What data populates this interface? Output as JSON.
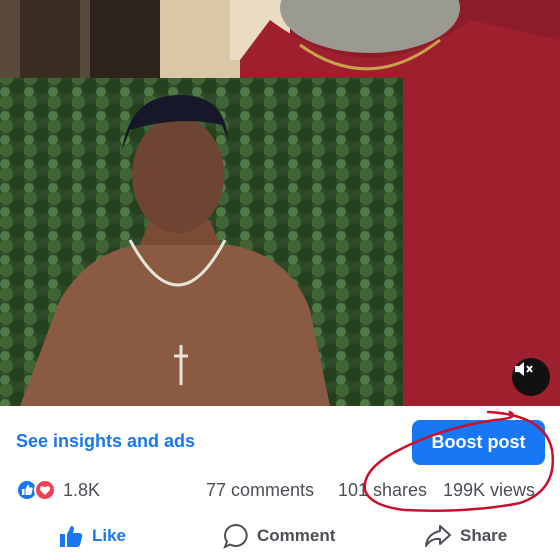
{
  "post": {
    "insights_label": "See insights and ads",
    "boost_label": "Boost post",
    "reaction_count": "1.8K",
    "comments": "77 comments",
    "shares": "101 shares",
    "views": "199K views"
  },
  "actions": {
    "like": "Like",
    "comment": "Comment",
    "share": "Share"
  },
  "icons": {
    "mute": "muted-speaker-icon",
    "like_reaction": "like-reaction-icon",
    "love_reaction": "love-reaction-icon",
    "like": "thumbs-up-icon",
    "comment": "comment-bubble-icon",
    "share": "share-arrow-icon"
  },
  "colors": {
    "accent": "#1877f2",
    "love": "#f33e58",
    "annotation": "#c8102e"
  }
}
